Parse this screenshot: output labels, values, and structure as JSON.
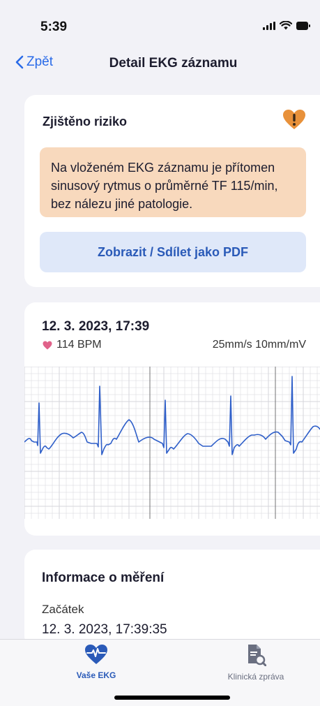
{
  "status": {
    "time": "5:39"
  },
  "nav": {
    "back_label": "Zpět",
    "title": "Detail EKG záznamu"
  },
  "risk_card": {
    "title": "Zjištěno riziko",
    "message": "Na vloženém EKG záznamu je přítomen sinusový rytmus o průměrné TF 115/min, bez nálezu jiné patologie.",
    "pdf_button": "Zobrazit / Sdílet jako PDF",
    "icon": "heart-warning-icon",
    "colors": {
      "warning_bg": "#f8d9bd",
      "button_bg": "#dfe8f9",
      "accent": "#2a5ab8",
      "warning_icon": "#e8913a"
    }
  },
  "ekg_card": {
    "date": "12. 3. 2023, 17:39",
    "bpm": "114 BPM",
    "scale": "25mm/s 10mm/mV",
    "colors": {
      "trace": "#2f5fc9",
      "grid": "#c9c9cf",
      "heart": "#e0628a"
    }
  },
  "info_card": {
    "title": "Informace o měření",
    "start_label": "Začátek",
    "start_value": "12. 3. 2023, 17:39:35"
  },
  "tabs": [
    {
      "label": "Vaše EKG",
      "icon": "heart-pulse-icon",
      "active": true
    },
    {
      "label": "Klinická zpráva",
      "icon": "document-search-icon",
      "active": false
    }
  ]
}
